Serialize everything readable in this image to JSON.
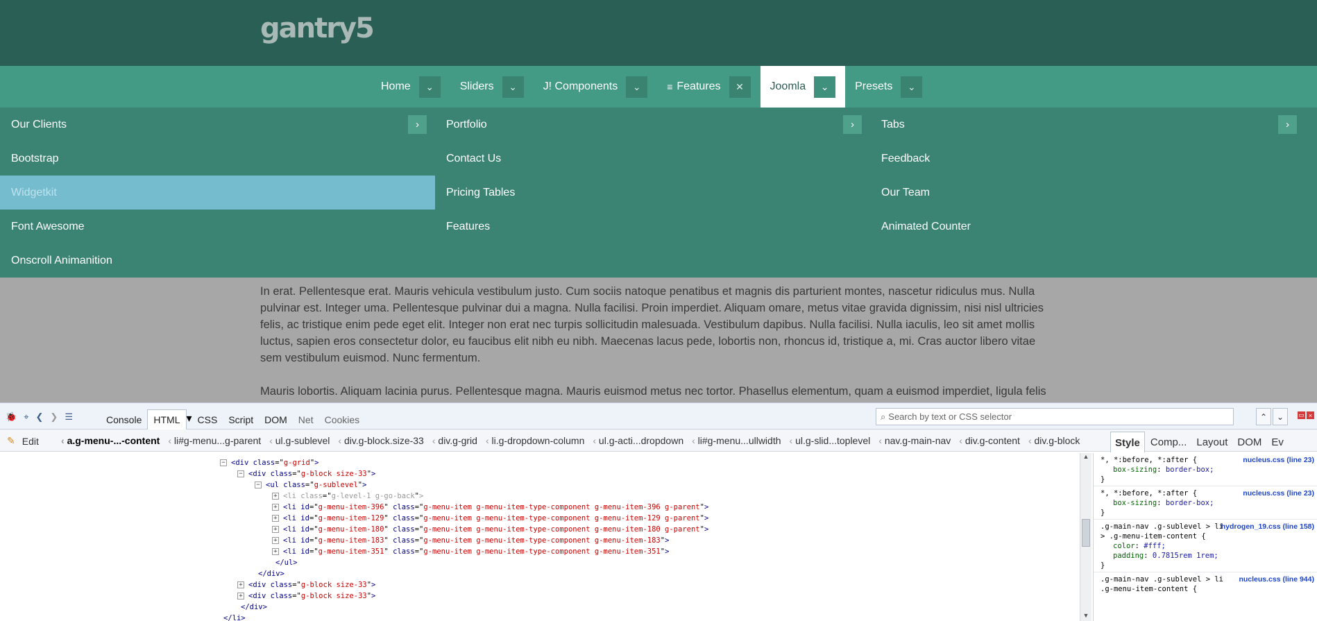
{
  "site": {
    "logo_text": "gantry5",
    "nav": [
      {
        "label": "Home",
        "toggle": "chevron-down"
      },
      {
        "label": "Sliders",
        "toggle": "chevron-down"
      },
      {
        "label": "J! Components",
        "toggle": "chevron-down"
      },
      {
        "label": "Features",
        "toggle": "close"
      },
      {
        "label": "Joomla",
        "toggle": "chevron-down",
        "active": true
      },
      {
        "label": "Presets",
        "toggle": "chevron-down"
      }
    ],
    "dropdown": {
      "col1": [
        "Our Clients",
        "Bootstrap",
        "Widgetkit",
        "Font Awesome",
        "Onscroll Animanition"
      ],
      "col2": [
        "Portfolio",
        "Contact Us",
        "Pricing Tables",
        "Features"
      ],
      "col3": [
        "Tabs",
        "Feedback",
        "Our Team",
        "Animated Counter"
      ],
      "hovered": "Widgetkit"
    },
    "paragraphs": [
      "In erat. Pellentesque erat. Mauris vehicula vestibulum justo. Cum sociis natoque penatibus et magnis dis parturient montes, nascetur ridiculus mus. Nulla pulvinar est. Integer uma. Pellentesque pulvinar dui a magna. Nulla facilisi. Proin imperdiet. Aliquam omare, metus vitae gravida dignissim, nisi nisl ultricies felis, ac tristique enim pede eget elit. Integer non erat nec turpis sollicitudin malesuada. Vestibulum dapibus. Nulla facilisi. Nulla iaculis, leo sit amet mollis luctus, sapien eros consectetur dolor, eu faucibus elit nibh eu nibh. Maecenas lacus pede, lobortis non, rhoncus id, tristique a, mi. Cras auctor libero vitae sem vestibulum euismod. Nunc fermentum.",
      "Mauris lobortis. Aliquam lacinia purus. Pellentesque magna. Mauris euismod metus nec tortor. Phasellus elementum, quam a euismod imperdiet, ligula felis"
    ]
  },
  "firebug": {
    "tabs": [
      "Console",
      "HTML",
      "CSS",
      "Script",
      "DOM",
      "Net",
      "Cookies"
    ],
    "active_tab": "HTML",
    "search_placeholder": "Search by text or CSS selector",
    "edit_label": "Edit",
    "breadcrumbs": [
      "a.g-menu-...-content",
      "li#g-menu...g-parent",
      "ul.g-sublevel",
      "div.g-block.size-33",
      "div.g-grid",
      "li.g-dropdown-column",
      "ul.g-acti...dropdown",
      "li#g-menu...ullwidth",
      "ul.g-slid...toplevel",
      "nav.g-main-nav",
      "div.g-content",
      "div.g-block"
    ],
    "side_tabs": [
      "Style",
      "Comp...",
      "Layout",
      "DOM",
      "Ev"
    ],
    "html_lines": [
      {
        "tag_open": "<div",
        "attr": "class",
        "val": "g-grid",
        "close": ">"
      },
      {
        "tag_open": "<div",
        "attr": "class",
        "val": "g-block size-33",
        "close": ">"
      },
      {
        "tag_open": "<ul",
        "attr": "class",
        "val": "g-sublevel",
        "close": ">"
      },
      {
        "tag_open": "<li",
        "attr": "class",
        "val": "g-level-1 g-go-back",
        "close": ">",
        "dim": true
      },
      {
        "tag_open": "<li",
        "attr": "id",
        "val": "g-menu-item-396",
        "attr2": "class",
        "val2": "g-menu-item g-menu-item-type-component g-menu-item-396 g-parent",
        "close": ">"
      },
      {
        "tag_open": "<li",
        "attr": "id",
        "val": "g-menu-item-129",
        "attr2": "class",
        "val2": "g-menu-item g-menu-item-type-component g-menu-item-129 g-parent",
        "close": ">"
      },
      {
        "tag_open": "<li",
        "attr": "id",
        "val": "g-menu-item-180",
        "attr2": "class",
        "val2": "g-menu-item g-menu-item-type-component g-menu-item-180 g-parent",
        "close": ">"
      },
      {
        "tag_open": "<li",
        "attr": "id",
        "val": "g-menu-item-183",
        "attr2": "class",
        "val2": "g-menu-item g-menu-item-type-component g-menu-item-183",
        "close": ">"
      },
      {
        "tag_open": "<li",
        "attr": "id",
        "val": "g-menu-item-351",
        "attr2": "class",
        "val2": "g-menu-item g-menu-item-type-component g-menu-item-351",
        "close": ">"
      },
      {
        "text": "</ul>"
      },
      {
        "text": "</div>"
      },
      {
        "tag_open": "<div",
        "attr": "class",
        "val": "g-block size-33",
        "close": ">"
      },
      {
        "tag_open": "<div",
        "attr": "class",
        "val": "g-block size-33",
        "close": ">"
      },
      {
        "text": "</div>"
      },
      {
        "text": "</li>"
      }
    ],
    "style_rules": [
      {
        "selector": "*, *:before, *:after {",
        "source": "nucleus.css (line 23)",
        "decls": [
          {
            "p": "box-sizing",
            "v": "border-box;"
          }
        ]
      },
      {
        "selector": "*, *:before, *:after {",
        "source": "nucleus.css (line 23)",
        "decls": [
          {
            "p": "box-sizing",
            "v": "border-box;"
          }
        ]
      },
      {
        "selector": ".g-main-nav .g-sublevel > li > .g-menu-item-content {",
        "source": "hydrogen_19.css (line 158)",
        "decls": [
          {
            "p": "color",
            "v": "#fff;"
          },
          {
            "p": "padding",
            "v": "0.7815rem 1rem;"
          }
        ]
      },
      {
        "selector": ".g-main-nav .g-sublevel > li .g-menu-item-content {",
        "source": "nucleus.css (line 944)",
        "decls": []
      }
    ]
  }
}
